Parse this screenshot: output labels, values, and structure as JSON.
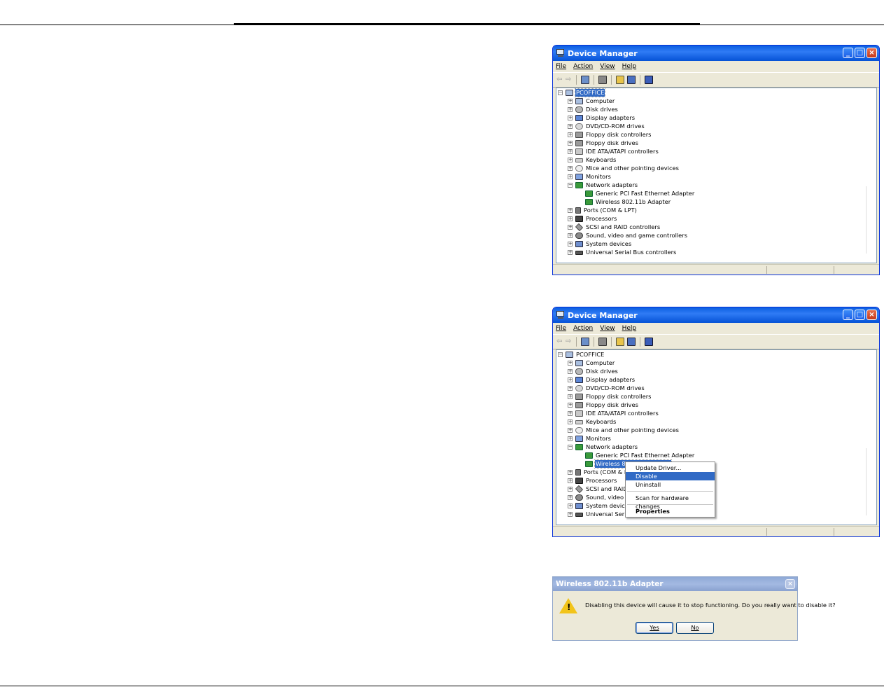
{
  "window_title": "Device Manager",
  "menu": [
    "File",
    "Action",
    "View",
    "Help"
  ],
  "tree": {
    "root": "PCOFFICE",
    "categories": [
      "Computer",
      "Disk drives",
      "Display adapters",
      "DVD/CD-ROM drives",
      "Floppy disk controllers",
      "Floppy disk drives",
      "IDE ATA/ATAPI controllers",
      "Keyboards",
      "Mice and other pointing devices",
      "Monitors",
      "Network adapters",
      "Ports (COM & LPT)",
      "Processors",
      "SCSI and RAID controllers",
      "Sound, video and game controllers",
      "System devices",
      "Universal Serial Bus controllers"
    ],
    "network_children": [
      "Generic PCI Fast Ethernet Adapter",
      "Wireless 802.11b Adapter"
    ]
  },
  "win2_truncated": {
    "ports": "Ports (COM & LP",
    "scsi": "SCSI and RAID",
    "sound": "Sound, video an",
    "system": "System devices",
    "usb": "Universal Serial",
    "wireless": "Wireless 802.11b Adapter"
  },
  "context_menu": {
    "update_driver": "Update Driver...",
    "disable": "Disable",
    "uninstall": "Uninstall",
    "scan": "Scan for hardware changes",
    "properties": "Properties"
  },
  "dialog": {
    "title": "Wireless 802.11b Adapter",
    "message": "Disabling this device will cause it to stop functioning. Do you really want to disable it?",
    "yes_label": "Yes",
    "no_label": "No"
  },
  "colors": {
    "selection": "#316ac5",
    "titlebar": "#0a5ee0"
  }
}
